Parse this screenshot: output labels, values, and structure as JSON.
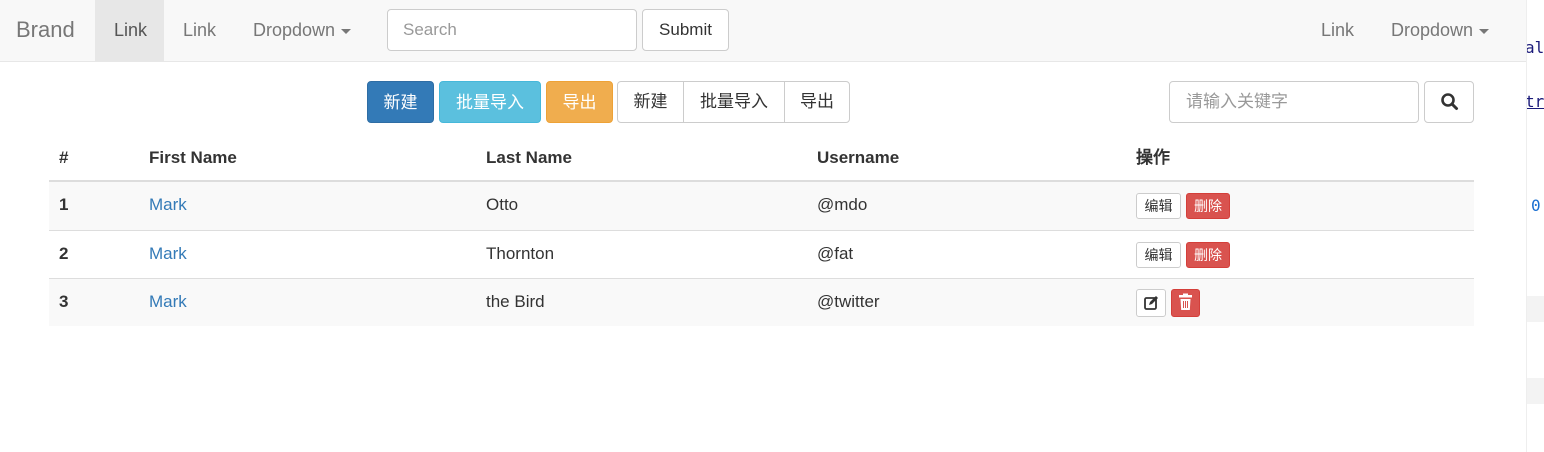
{
  "navbar": {
    "brand": "Brand",
    "links": [
      "Link",
      "Link"
    ],
    "dropdown_label": "Dropdown",
    "search_placeholder": "Search",
    "submit_label": "Submit",
    "right_link": "Link",
    "right_dropdown_label": "Dropdown"
  },
  "toolbar": {
    "buttons": [
      "新建",
      "批量导入",
      "导出"
    ],
    "group_buttons": [
      "新建",
      "批量导入",
      "导出"
    ],
    "keyword_placeholder": "请输入关键字",
    "search_icon": "search-icon"
  },
  "table": {
    "headers": [
      "#",
      "First Name",
      "Last Name",
      "Username",
      "操作"
    ],
    "rows": [
      {
        "num": "1",
        "first": "Mark",
        "last": "Otto",
        "username": "@mdo",
        "edit": "编辑",
        "delete": "删除"
      },
      {
        "num": "2",
        "first": "Mark",
        "last": "Thornton",
        "username": "@fat",
        "edit": "编辑",
        "delete": "删除"
      },
      {
        "num": "3",
        "first": "Mark",
        "last": "the Bird",
        "username": "@twitter",
        "edit_icon": "edit-icon",
        "delete_icon": "trash-icon"
      }
    ]
  },
  "side_code": {
    "line1": "al",
    "line2": "tr",
    "line3": "0"
  },
  "colors": {
    "primary": "#337ab7",
    "info": "#5bc0de",
    "warning": "#f0ad4e",
    "danger": "#d9534f",
    "link": "#337ab7"
  }
}
